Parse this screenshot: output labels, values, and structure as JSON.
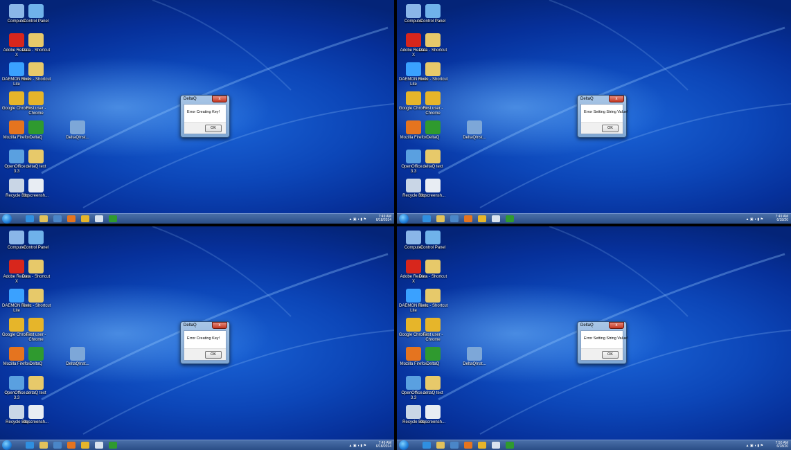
{
  "desktop_icons": [
    {
      "label": "Computer",
      "glyph": "computer-icon",
      "color": "#8ab6e8"
    },
    {
      "label": "Control Panel",
      "glyph": "control-panel-icon",
      "color": "#6fb2ea"
    },
    {
      "label": "Adobe Reader X",
      "glyph": "adobe-reader-icon",
      "color": "#d8261c"
    },
    {
      "label": "Data - Shortcut",
      "glyph": "folder-icon",
      "color": "#e7c96a"
    },
    {
      "label": "DAEMON Tools Lite",
      "glyph": "daemon-tools-icon",
      "color": "#3aa1ff"
    },
    {
      "label": "Rivec - Shortcut",
      "glyph": "folder-icon",
      "color": "#e7c96a"
    },
    {
      "label": "Google Chrome",
      "glyph": "chrome-icon",
      "color": "#e6b52a"
    },
    {
      "label": "First user - Chrome",
      "glyph": "chrome-icon",
      "color": "#e6b52a"
    },
    {
      "label": "Mozilla Firefox",
      "glyph": "firefox-icon",
      "color": "#e5741f"
    },
    {
      "label": "DeltaQ",
      "glyph": "deltaq-icon",
      "color": "#2f9a2f"
    },
    {
      "label": "OpenOffice... 3.3",
      "glyph": "openoffice-icon",
      "color": "#5aa0e0"
    },
    {
      "label": "deltaQ text",
      "glyph": "folder-icon",
      "color": "#e7c96a"
    },
    {
      "label": "Recycle Bin",
      "glyph": "recycle-bin-icon",
      "color": "#c9d6e6"
    },
    {
      "label": "dqscreensh...",
      "glyph": "document-icon",
      "color": "#e8edf3"
    },
    {
      "label": "DeltaQInst...",
      "glyph": "installer-icon",
      "color": "#7da7d8"
    }
  ],
  "screens": [
    {
      "dialog": {
        "title": "DeltaQ",
        "message": "Error Creating Key!",
        "ok_label": "OK",
        "close_label": "x"
      },
      "clock": {
        "time": "7:49 AM",
        "date": "6/18/2014"
      }
    },
    {
      "dialog": {
        "title": "DeltaQ",
        "message": "Error Setting String Value!",
        "ok_label": "OK",
        "close_label": "x"
      },
      "clock": {
        "time": "7:49 AM",
        "date": "6/18/20"
      }
    },
    {
      "dialog": {
        "title": "DeltaQ",
        "message": "Error Creating Key!",
        "ok_label": "OK",
        "close_label": "x"
      },
      "clock": {
        "time": "7:49 AM",
        "date": "6/18/2014"
      }
    },
    {
      "dialog": {
        "title": "DeltaQ",
        "message": "Error Setting String Value!",
        "ok_label": "OK",
        "close_label": "x"
      },
      "clock": {
        "time": "7:50 AM",
        "date": "6/18/20"
      }
    }
  ],
  "taskbar_items": [
    {
      "name": "internet-explorer-icon",
      "color": "#2f8fe0"
    },
    {
      "name": "windows-explorer-icon",
      "color": "#e2c25b"
    },
    {
      "name": "media-player-icon",
      "color": "#4a86c8"
    },
    {
      "name": "firefox-icon",
      "color": "#e5741f"
    },
    {
      "name": "chrome-icon",
      "color": "#e6b52a"
    },
    {
      "name": "deltaq-setup-icon",
      "color": "#d9e3ee"
    },
    {
      "name": "deltaq-icon",
      "color": "#2f9a2f"
    }
  ],
  "tray_glyphs": "▲ ▣ ◖ ▮ ⚑"
}
